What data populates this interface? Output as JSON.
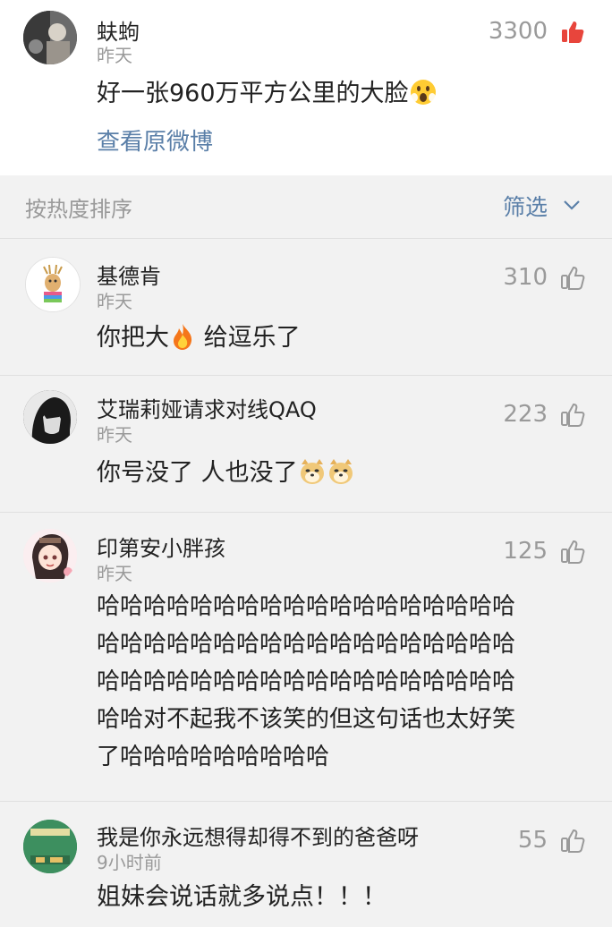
{
  "top_comment": {
    "author": "蚨蚼",
    "time": "昨天",
    "likes": "3300",
    "text": "好一张960万平方公里的大脸",
    "view_original": "查看原微博"
  },
  "sort_bar": {
    "label": "按热度排序",
    "filter": "筛选"
  },
  "comments": [
    {
      "author": "基德肯",
      "time": "昨天",
      "likes": "310",
      "text_before": "你把大",
      "text_after": " 给逗乐了"
    },
    {
      "author": "艾瑞莉娅请求对线QAQ",
      "time": "昨天",
      "likes": "223",
      "text": "你号没了 人也没了"
    },
    {
      "author": "印第安小胖孩",
      "time": "昨天",
      "likes": "125",
      "lines": [
        "哈哈哈哈哈哈哈哈哈哈哈哈哈哈哈哈哈哈",
        "哈哈哈哈哈哈哈哈哈哈哈哈哈哈哈哈哈哈",
        "哈哈哈哈哈哈哈哈哈哈哈哈哈哈哈哈哈哈",
        "哈哈对不起我不该笑的但这句话也太好笑",
        "了哈哈哈哈哈哈哈哈哈"
      ]
    },
    {
      "author": "我是你永远想得却得不到的爸爸呀",
      "time": "9小时前",
      "likes": "55",
      "text": "姐妹会说话就多说点！！！"
    }
  ],
  "colors": {
    "link": "#5a7fa8",
    "liked": "#e8453c",
    "muted": "#9a9a9a"
  }
}
